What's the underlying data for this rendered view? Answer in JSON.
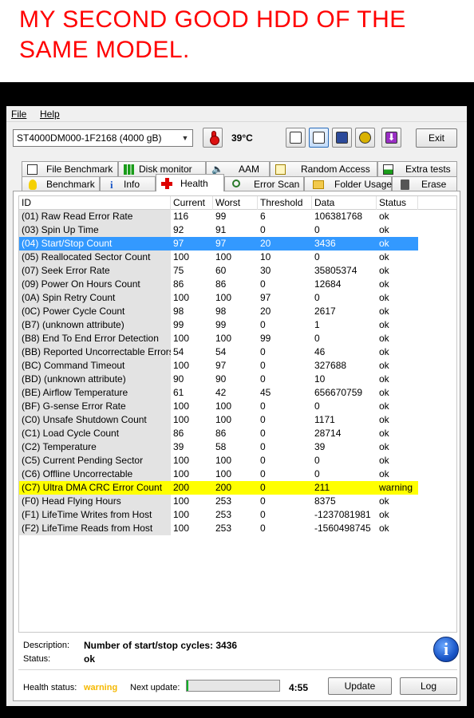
{
  "caption": "MY SECOND GOOD HDD OF THE SAME MODEL.",
  "menu": {
    "file": "File",
    "help": "Help"
  },
  "toolbar": {
    "drive": "ST4000DM000-1F2168 (4000 gB)",
    "temperature": "39°C",
    "exit_label": "Exit"
  },
  "tabs_top": [
    "File Benchmark",
    "Disk monitor",
    "AAM",
    "Random Access",
    "Extra tests"
  ],
  "tabs_bottom": [
    "Benchmark",
    "Info",
    "Health",
    "Error Scan",
    "Folder Usage",
    "Erase"
  ],
  "active_tab": "Health",
  "table": {
    "columns": [
      "ID",
      "Current",
      "Worst",
      "Threshold",
      "Data",
      "Status"
    ],
    "rows": [
      [
        "(01) Raw Read Error Rate",
        "116",
        "99",
        "6",
        "106381768",
        "ok"
      ],
      [
        "(03) Spin Up Time",
        "92",
        "91",
        "0",
        "0",
        "ok"
      ],
      [
        "(04) Start/Stop Count",
        "97",
        "97",
        "20",
        "3436",
        "ok"
      ],
      [
        "(05) Reallocated Sector Count",
        "100",
        "100",
        "10",
        "0",
        "ok"
      ],
      [
        "(07) Seek Error Rate",
        "75",
        "60",
        "30",
        "35805374",
        "ok"
      ],
      [
        "(09) Power On Hours Count",
        "86",
        "86",
        "0",
        "12684",
        "ok"
      ],
      [
        "(0A) Spin Retry Count",
        "100",
        "100",
        "97",
        "0",
        "ok"
      ],
      [
        "(0C) Power Cycle Count",
        "98",
        "98",
        "20",
        "2617",
        "ok"
      ],
      [
        "(B7) (unknown attribute)",
        "99",
        "99",
        "0",
        "1",
        "ok"
      ],
      [
        "(B8) End To End Error Detection",
        "100",
        "100",
        "99",
        "0",
        "ok"
      ],
      [
        "(BB) Reported Uncorrectable Errors",
        "54",
        "54",
        "0",
        "46",
        "ok"
      ],
      [
        "(BC) Command Timeout",
        "100",
        "97",
        "0",
        "327688",
        "ok"
      ],
      [
        "(BD) (unknown attribute)",
        "90",
        "90",
        "0",
        "10",
        "ok"
      ],
      [
        "(BE) Airflow Temperature",
        "61",
        "42",
        "45",
        "656670759",
        "ok"
      ],
      [
        "(BF) G-sense Error Rate",
        "100",
        "100",
        "0",
        "0",
        "ok"
      ],
      [
        "(C0) Unsafe Shutdown Count",
        "100",
        "100",
        "0",
        "1171",
        "ok"
      ],
      [
        "(C1) Load Cycle Count",
        "86",
        "86",
        "0",
        "28714",
        "ok"
      ],
      [
        "(C2) Temperature",
        "39",
        "58",
        "0",
        "39",
        "ok"
      ],
      [
        "(C5) Current Pending Sector",
        "100",
        "100",
        "0",
        "0",
        "ok"
      ],
      [
        "(C6) Offline Uncorrectable",
        "100",
        "100",
        "0",
        "0",
        "ok"
      ],
      [
        "(C7) Ultra DMA CRC Error Count",
        "200",
        "200",
        "0",
        "211",
        "warning"
      ],
      [
        "(F0) Head Flying Hours",
        "100",
        "253",
        "0",
        "8375",
        "ok"
      ],
      [
        "(F1) LifeTime Writes from Host",
        "100",
        "253",
        "0",
        "-1237081981",
        "ok"
      ],
      [
        "(F2) LifeTime Reads from Host",
        "100",
        "253",
        "0",
        "-1560498745",
        "ok"
      ]
    ],
    "selected_row": 2,
    "warning_row": 20
  },
  "details": {
    "description_label": "Description:",
    "description_value": "Number of start/stop cycles: 3436",
    "status_label": "Status:",
    "status_value": "ok"
  },
  "footer": {
    "health_label": "Health status:",
    "health_value": "warning",
    "next_update_label": "Next update:",
    "next_update_time": "4:55",
    "progress_fraction": 0.02,
    "update_label": "Update",
    "log_label": "Log"
  },
  "colors": {
    "caption": "#ff0000",
    "selection": "#3399ff",
    "warning_row": "#ffff00",
    "warning_text": "#f5b800",
    "progress": "#06b025"
  }
}
